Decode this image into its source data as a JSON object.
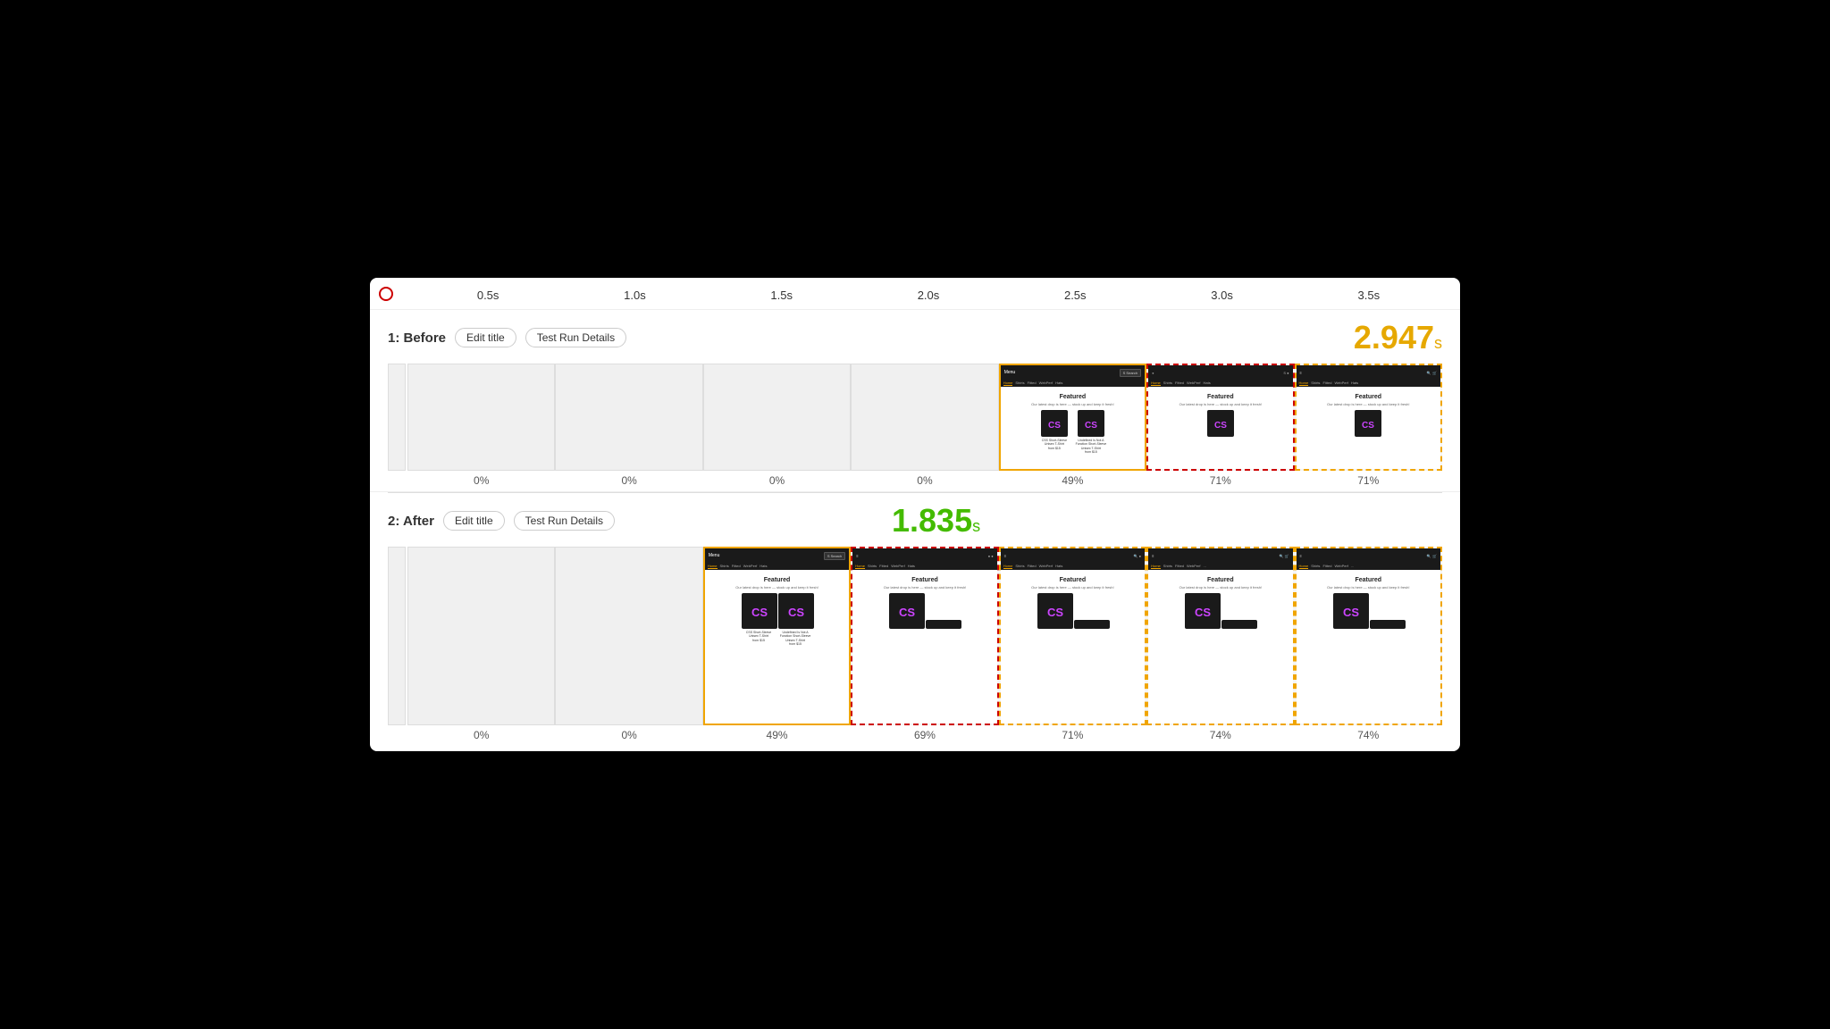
{
  "timeline": {
    "ticks": [
      "0.5s",
      "1.0s",
      "1.5s",
      "2.0s",
      "2.5s",
      "3.0s",
      "3.5s"
    ]
  },
  "before": {
    "label": "1: Before",
    "edit_title": "Edit title",
    "test_run": "Test Run Details",
    "score": "2.947",
    "score_unit": "s",
    "frames": [
      {
        "pct": "0%",
        "type": "blank"
      },
      {
        "pct": "0%",
        "type": "blank"
      },
      {
        "pct": "0%",
        "type": "blank"
      },
      {
        "pct": "0%",
        "type": "blank"
      },
      {
        "pct": "49%",
        "type": "content-yellow"
      },
      {
        "pct": "71%",
        "type": "content-red"
      },
      {
        "pct": "71%",
        "type": "content-yellow-dashed"
      }
    ]
  },
  "after": {
    "label": "2: After",
    "edit_title": "Edit title",
    "test_run": "Test Run Details",
    "score": "1.835",
    "score_unit": "s",
    "frames": [
      {
        "pct": "0%",
        "type": "blank"
      },
      {
        "pct": "0%",
        "type": "blank"
      },
      {
        "pct": "49%",
        "type": "content-yellow"
      },
      {
        "pct": "69%",
        "type": "content-red"
      },
      {
        "pct": "71%",
        "type": "content-yellow-dashed"
      },
      {
        "pct": "74%",
        "type": "content-yellow-dashed"
      },
      {
        "pct": "74%",
        "type": "content-yellow-dashed"
      }
    ]
  }
}
